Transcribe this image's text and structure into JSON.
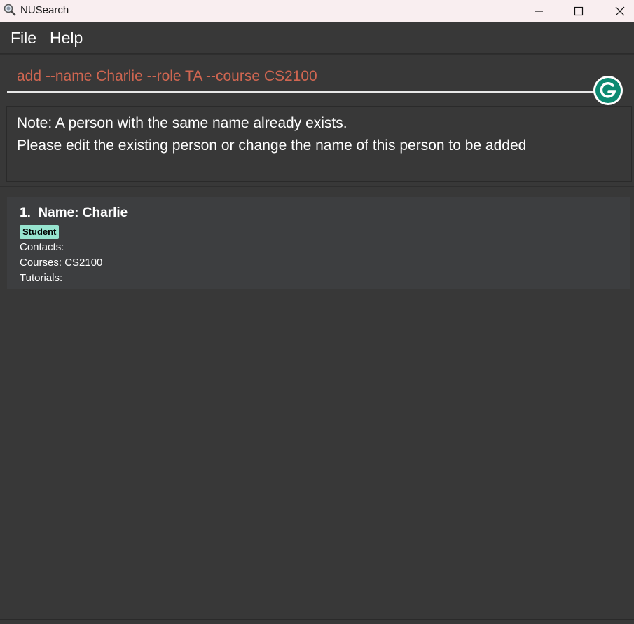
{
  "window": {
    "title": "NUSearch",
    "icon": "magnifier-app-icon",
    "controls": [
      "minimize-icon",
      "maximize-icon",
      "close-icon"
    ]
  },
  "menu": {
    "file": "File",
    "help": "Help"
  },
  "command": {
    "value": "add --name Charlie --role TA --course CS2100",
    "text_color": "#d06651"
  },
  "result": {
    "line1": "Note: A person with the same name already exists.",
    "line2": "Please edit the existing person or change the name of this person to be added"
  },
  "persons": [
    {
      "index": "1.",
      "name_line": "Name: Charlie",
      "tag": "Student",
      "contacts": "Contacts:",
      "courses": "Courses: CS2100",
      "tutorials": "Tutorials:"
    }
  ],
  "colors": {
    "background": "#383838",
    "card": "#3d3e40",
    "tag": "#97e4cf",
    "titlebar": "#f9eef0",
    "grammarly": "#0c8a72"
  }
}
